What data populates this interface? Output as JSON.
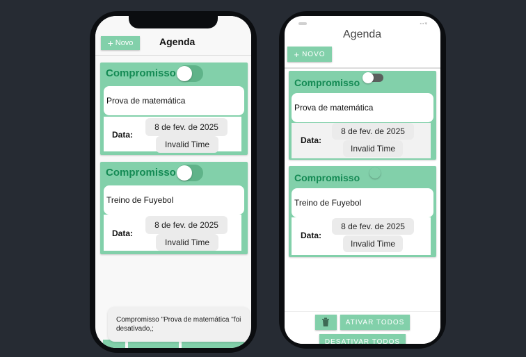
{
  "left_app": {
    "header": {
      "new_button": "Novo",
      "title": "Agenda"
    },
    "cards": [
      {
        "title": "Compromisso",
        "description": "Prova de matemática",
        "date_label": "Data:",
        "date": "8 de fev. de 2025",
        "time": "Invalid Time"
      },
      {
        "title": "Compromisso",
        "description": "Treino de Fuyebol",
        "date_label": "Data:",
        "date": "8 de fev. de 2025",
        "time": "Invalid Time"
      }
    ],
    "toast": "Compromisso \"Prova de matemática \"foi desativado,;"
  },
  "right_app": {
    "header": {
      "title": "Agenda",
      "new_button": "NOVO"
    },
    "cards": [
      {
        "title": "Compromisso",
        "description": "Prova de matemática",
        "date_label": "Data:",
        "date": "8 de fev. de 2025",
        "time": "Invalid Time"
      },
      {
        "title": "Compromisso",
        "description": "Treino de Fuyebol",
        "date_label": "Data:",
        "date": "8 de fev. de 2025",
        "time": "Invalid Time"
      }
    ],
    "footer": {
      "activate_all": "ATIVAR TODOS",
      "deactivate_all": "DESATIVAR TODOS"
    }
  },
  "icons": {
    "new": "plus-icon",
    "delete": "trash-icon"
  },
  "colors": {
    "accent": "#82d0aa",
    "accent_text": "#148a54",
    "background": "#262b33"
  }
}
